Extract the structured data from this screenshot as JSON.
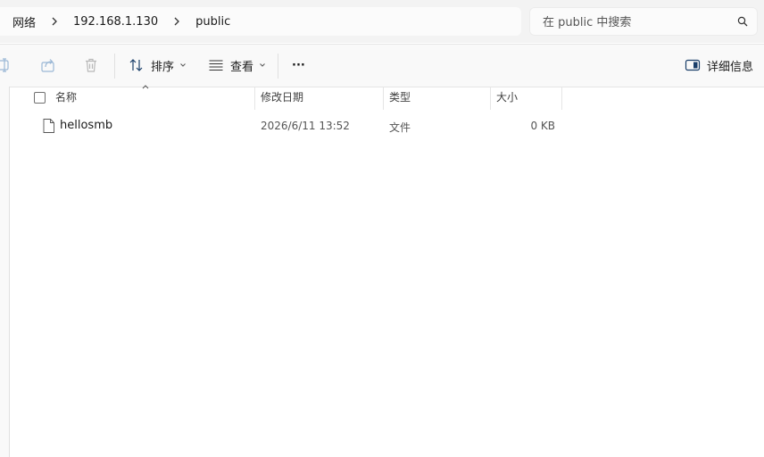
{
  "breadcrumb": {
    "items": [
      "网络",
      "192.168.1.130",
      "public"
    ]
  },
  "search": {
    "placeholder": "在 public 中搜索"
  },
  "toolbar": {
    "sort_label": "排序",
    "view_label": "查看",
    "more_label": "···",
    "details_label": "详细信息"
  },
  "columns": {
    "name": "名称",
    "modified": "修改日期",
    "type": "类型",
    "size": "大小"
  },
  "files": [
    {
      "name": "hellosmb",
      "modified": "2026/6/11 13:52",
      "type": "文件",
      "size": "0 KB"
    }
  ]
}
